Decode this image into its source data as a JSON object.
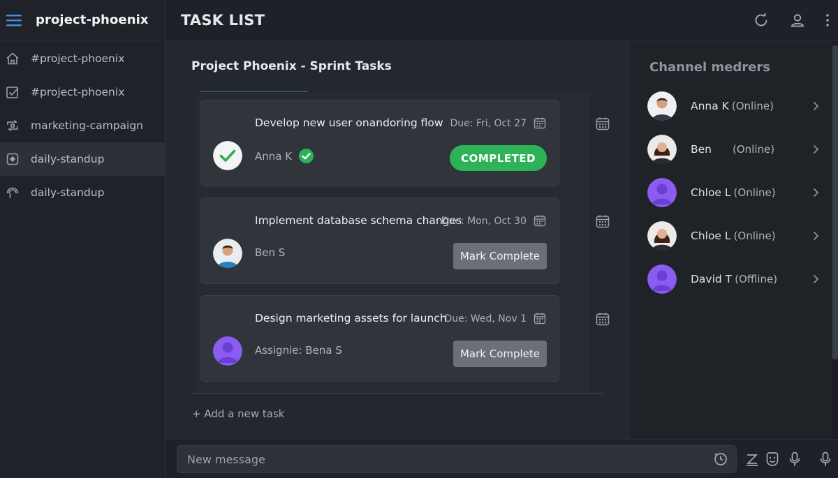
{
  "sidebar": {
    "workspace": "project-phoenix",
    "channels": [
      {
        "label": "#project-phoenix",
        "icon": "home-icon"
      },
      {
        "label": "#project-phoenix",
        "icon": "checkbox-icon"
      },
      {
        "label": "marketing-campaign",
        "icon": "sync-icon"
      },
      {
        "label": "daily-standup",
        "icon": "plus-square-icon",
        "active": true
      },
      {
        "label": "daily-standup",
        "icon": "umbrella-icon"
      }
    ]
  },
  "header": {
    "title": "TASK LIST",
    "icons": [
      "refresh-icon",
      "user-icon",
      "more-vertical-icon"
    ]
  },
  "main": {
    "section_title": "Project Phoenix - Sprint Tasks",
    "tasks": [
      {
        "title": "Develop new user onandoring flow",
        "due": "Due: Fri, Oct 27",
        "assignee": "Anna K",
        "status": "COMPLETED"
      },
      {
        "title": "Implement database schema changes",
        "due": "Due: Mon, Oct 30",
        "assignee": "Ben S",
        "action": "Mark Complete"
      },
      {
        "title": "Design marketing assets for launch",
        "due": "Due: Wed, Nov 1",
        "assignee": "Assignie: Bena S",
        "action": "Mark Complete"
      }
    ],
    "add_task": "+ Add a new task"
  },
  "members": {
    "title": "Channel medrers",
    "list": [
      {
        "name": "Anna K",
        "status": "(Online)"
      },
      {
        "name": "Ben",
        "status": "(Online)"
      },
      {
        "name": "Chloe L",
        "status": "(Online)"
      },
      {
        "name": "Chloe L",
        "status": "(Online)"
      },
      {
        "name": "David T",
        "status": "(Offline)"
      }
    ]
  },
  "composer": {
    "placeholder": "New message",
    "icons": [
      "emoji-clock-icon",
      "format-icon",
      "sticker-icon",
      "mic-icon",
      "mic-icon"
    ]
  },
  "colors": {
    "accent_blue": "#4a90d9",
    "success_green": "#2eb257",
    "placeholder_purple": "#8a5cf0"
  }
}
